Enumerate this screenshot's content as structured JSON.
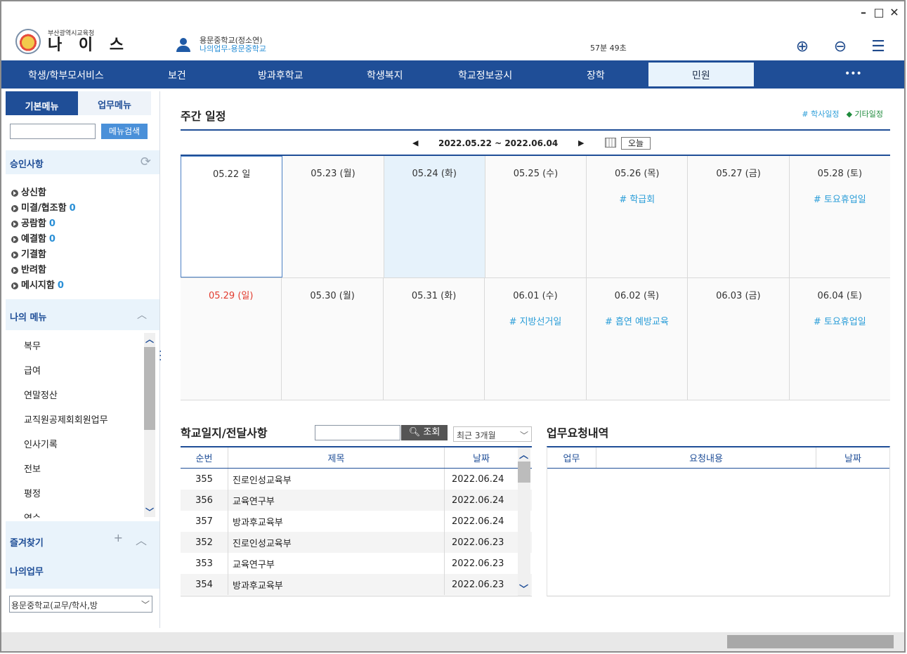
{
  "window": {
    "minimize": "–",
    "maximize": "□",
    "close": "✕"
  },
  "header": {
    "org": "부산광역시교육청",
    "app_name": "나 이 스",
    "user_name": "용문중학교(정소연)",
    "user_dept": "나의업무-용문중학교",
    "timer": "57분 49초",
    "zoom_in": "⊕",
    "zoom_out": "⊖",
    "menu": "☰"
  },
  "nav": {
    "items": [
      "학생/학부모서비스",
      "보건",
      "방과후학교",
      "학생복지",
      "학교정보공시",
      "장학",
      "민원",
      "•••"
    ]
  },
  "sidebar": {
    "tab_basic": "기본메뉴",
    "tab_work": "업무메뉴",
    "search_button": "메뉴검색",
    "approval_title": "승인사항",
    "approval_items": [
      {
        "label": "상신함",
        "count": ""
      },
      {
        "label": "미결/협조함",
        "count": "0"
      },
      {
        "label": "공람함",
        "count": "0"
      },
      {
        "label": "예결함",
        "count": "0"
      },
      {
        "label": "기결함",
        "count": ""
      },
      {
        "label": "반려함",
        "count": ""
      },
      {
        "label": "메시지함",
        "count": "0"
      }
    ],
    "my_menu_title": "나의 메뉴",
    "my_menu_items": [
      "복무",
      "급여",
      "연말정산",
      "교직원공제회회원업무",
      "인사기록",
      "전보",
      "평정",
      "연수"
    ],
    "favorites_title": "즐겨찾기",
    "my_work_title": "나의업무",
    "school_select": "용문중학교(교무/학사,방"
  },
  "weekly": {
    "title": "주간 일정",
    "legend_school": "# 학사일정",
    "legend_other": "◆ 기타일정",
    "range": "2022.05.22 ~ 2022.06.04",
    "today_button": "오늘",
    "week1": [
      {
        "date": "05.22 일",
        "event": ""
      },
      {
        "date": "05.23 (월)",
        "event": ""
      },
      {
        "date": "05.24 (화)",
        "event": ""
      },
      {
        "date": "05.25 (수)",
        "event": ""
      },
      {
        "date": "05.26 (목)",
        "event": "# 학급회"
      },
      {
        "date": "05.27 (금)",
        "event": ""
      },
      {
        "date": "05.28 (토)",
        "event": "# 토요휴업일"
      }
    ],
    "week2": [
      {
        "date": "05.29 (일)",
        "event": ""
      },
      {
        "date": "05.30 (월)",
        "event": ""
      },
      {
        "date": "05.31 (화)",
        "event": ""
      },
      {
        "date": "06.01 (수)",
        "event": "# 지방선거일"
      },
      {
        "date": "06.02 (목)",
        "event": "# 흡연 예방교육"
      },
      {
        "date": "06.03 (금)",
        "event": ""
      },
      {
        "date": "06.04 (토)",
        "event": "# 토요휴업일"
      }
    ]
  },
  "board": {
    "title": "학교일지/전달사항",
    "search_button": "조회",
    "range_select": "최근 3개월",
    "headers": [
      "순번",
      "제목",
      "날짜"
    ],
    "rows": [
      [
        "355",
        "진로인성교육부",
        "2022.06.24"
      ],
      [
        "356",
        "교육연구부",
        "2022.06.24"
      ],
      [
        "357",
        "방과후교육부",
        "2022.06.24"
      ],
      [
        "352",
        "진로인성교육부",
        "2022.06.23"
      ],
      [
        "353",
        "교육연구부",
        "2022.06.23"
      ],
      [
        "354",
        "방과후교육부",
        "2022.06.23"
      ]
    ]
  },
  "requests": {
    "title": "업무요청내역",
    "headers": [
      "업무",
      "요청내용",
      "날짜"
    ]
  }
}
